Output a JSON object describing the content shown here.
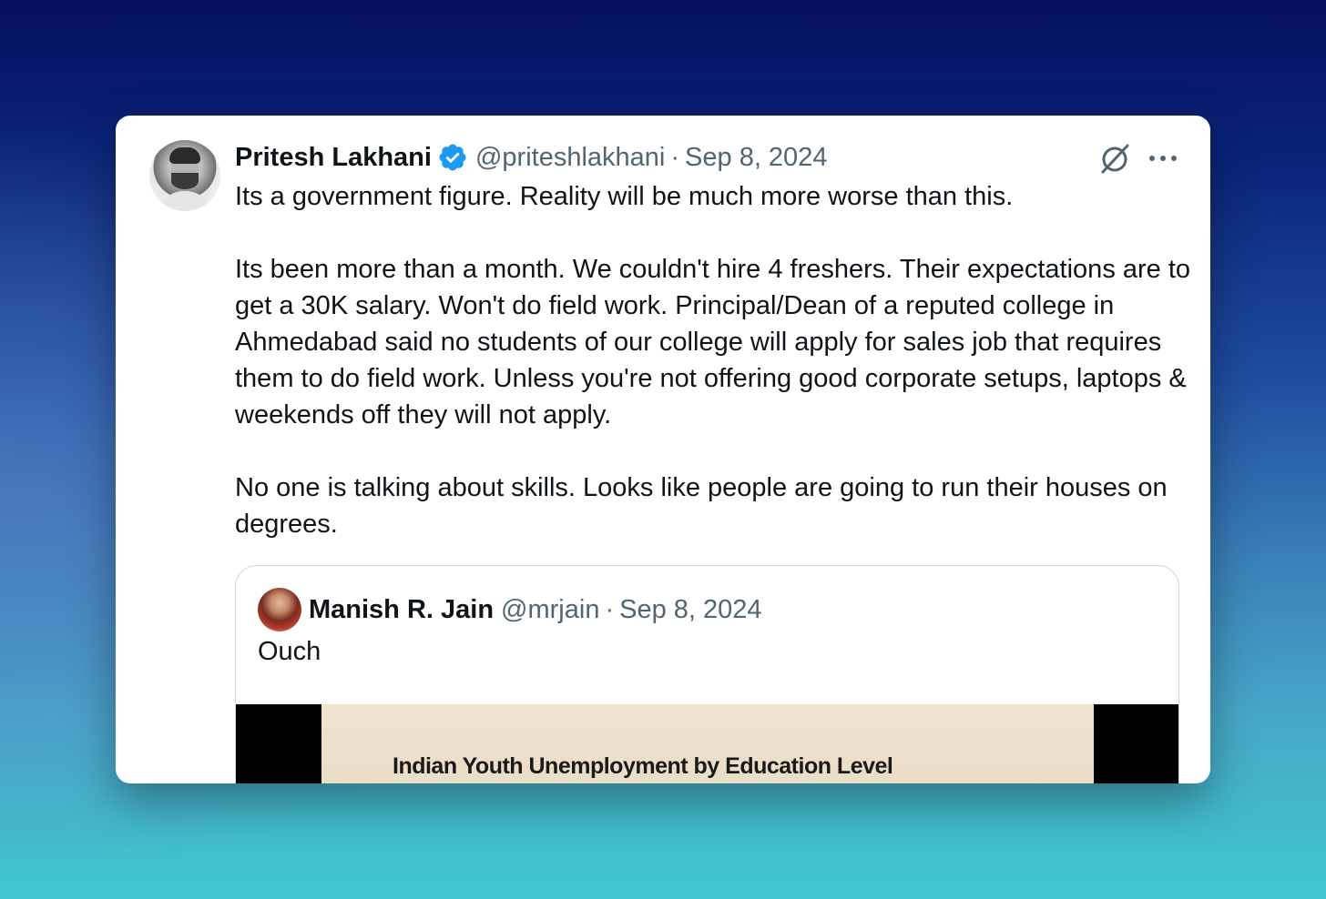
{
  "tweet": {
    "author_name": "Pritesh Lakhani",
    "author_handle": "@priteshlakhani",
    "separator": "·",
    "date": "Sep 8, 2024",
    "paragraphs": [
      "Its a government figure. Reality will be much more worse than this.",
      "Its been more than a month. We couldn't hire 4 freshers. Their expectations are to get a 30K salary. Won't do field work. Principal/Dean of a reputed college in Ahmedabad said no students of our college will apply for sales job that requires them to do field work. Unless you're not offering good corporate setups, laptops & weekends off they will not apply.",
      "No one is talking about skills. Looks like people are going to run their houses on degrees."
    ],
    "icons": {
      "verified": "verified-badge-icon",
      "grok": "grok-icon",
      "more": "more-options-icon"
    }
  },
  "quoted_tweet": {
    "author_name": "Manish R. Jain",
    "author_handle": "@mrjain",
    "separator": "·",
    "date": "Sep 8, 2024",
    "text": "Ouch",
    "media_title": "Indian Youth Unemployment by Education Level"
  },
  "colors": {
    "verified_blue": "#1d9bf0",
    "text_primary": "#0f1419",
    "text_secondary": "#536471",
    "quote_border": "#cfd9de"
  }
}
